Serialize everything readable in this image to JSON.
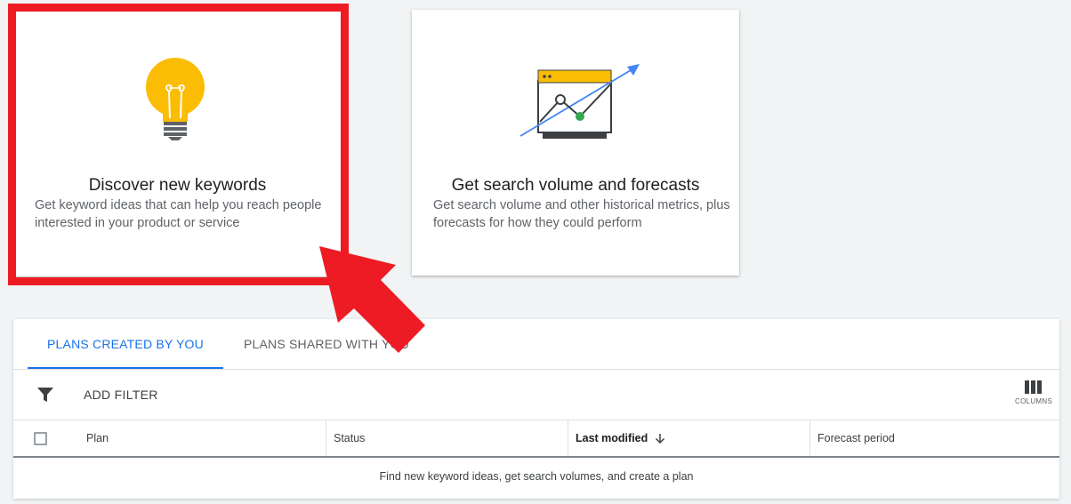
{
  "cards": {
    "discover": {
      "title": "Discover new keywords",
      "description": "Get keyword ideas that can help you reach people interested in your product or service"
    },
    "forecast": {
      "title": "Get search volume and forecasts",
      "description": "Get search volume and other historical metrics, plus forecasts for how they could perform"
    }
  },
  "plans": {
    "tabs": [
      {
        "label": "PLANS CREATED BY YOU",
        "active": true
      },
      {
        "label": "PLANS SHARED WITH YOU",
        "active": false
      }
    ],
    "filter_label": "ADD FILTER",
    "columns_label": "COLUMNS",
    "table": {
      "headers": [
        "Plan",
        "Status",
        "Last modified",
        "Forecast period"
      ],
      "sorted_column": "Last modified",
      "sort_direction": "descending",
      "empty_message": "Find new keyword ideas, get search volumes, and create a plan"
    }
  },
  "icons": {
    "discover": "lightbulb-icon",
    "forecast": "chart-window-icon",
    "filter": "filter-icon",
    "columns": "columns-icon",
    "sort": "arrow-down-icon",
    "annotation": "red-arrow-icon"
  },
  "colors": {
    "accent": "#1a73e8",
    "highlight": "#ed1c24",
    "bulb": "#fbbc04",
    "chart_point": "#34a853",
    "trend_arrow": "#4285f4"
  }
}
